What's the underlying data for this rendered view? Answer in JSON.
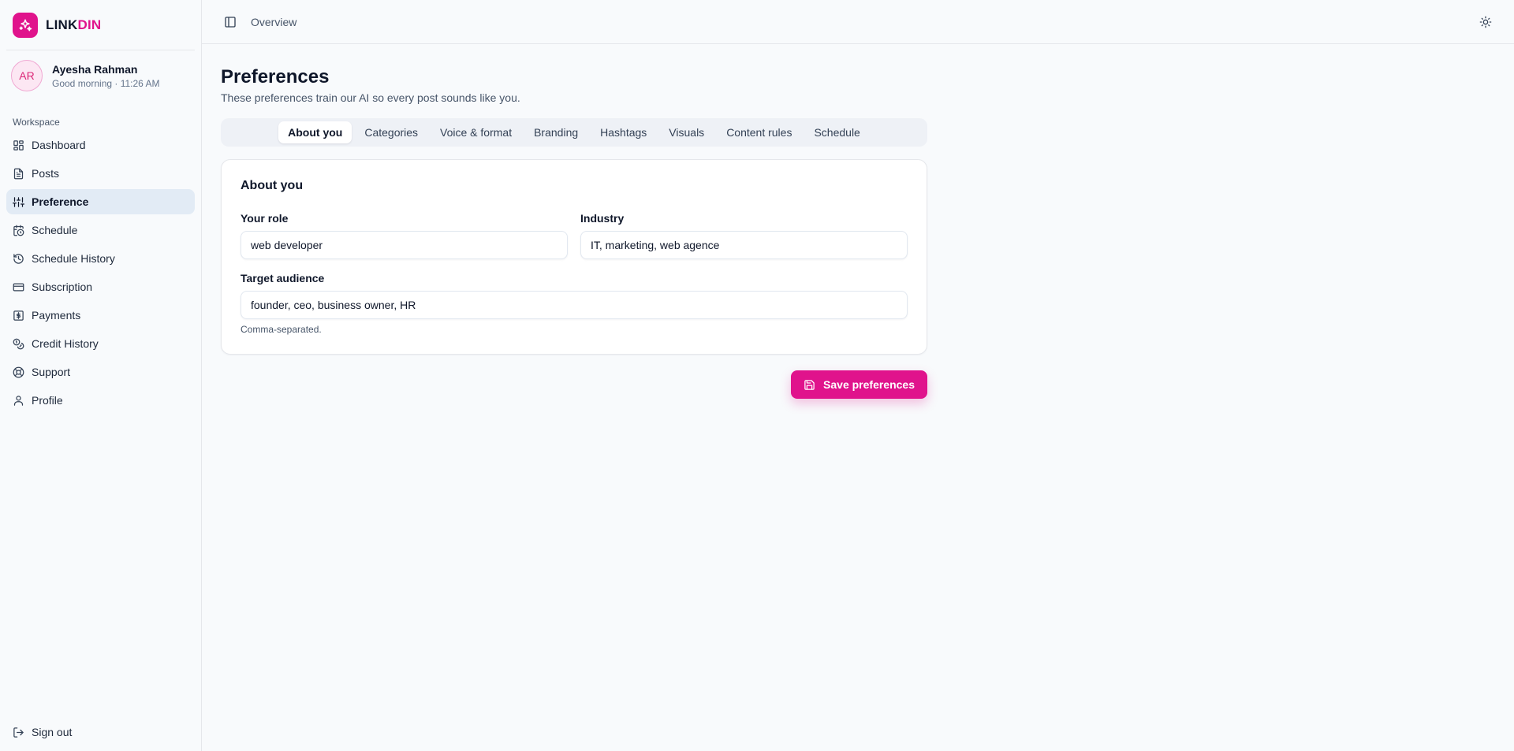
{
  "brand": {
    "name_part1": "LINK",
    "name_part2": "DIN",
    "accent": "#e0138c",
    "icon": "sparkles-icon"
  },
  "user": {
    "initials": "AR",
    "name": "Ayesha Rahman",
    "greeting": "Good morning · 11:26 AM"
  },
  "sidebar": {
    "section_label": "Workspace",
    "items": [
      {
        "label": "Dashboard",
        "icon": "dashboard-icon",
        "active": false
      },
      {
        "label": "Posts",
        "icon": "document-icon",
        "active": false
      },
      {
        "label": "Preference",
        "icon": "sliders-icon",
        "active": true
      },
      {
        "label": "Schedule",
        "icon": "calendar-clock-icon",
        "active": false
      },
      {
        "label": "Schedule History",
        "icon": "history-icon",
        "active": false
      },
      {
        "label": "Subscription",
        "icon": "credit-card-icon",
        "active": false
      },
      {
        "label": "Payments",
        "icon": "dollar-icon",
        "active": false
      },
      {
        "label": "Credit History",
        "icon": "coins-icon",
        "active": false
      },
      {
        "label": "Support",
        "icon": "lifebuoy-icon",
        "active": false
      },
      {
        "label": "Profile",
        "icon": "user-icon",
        "active": false
      }
    ],
    "signout_label": "Sign out"
  },
  "topbar": {
    "breadcrumb": "Overview"
  },
  "page": {
    "title": "Preferences",
    "subtitle": "These preferences train our AI so every post sounds like you."
  },
  "tabs": [
    {
      "label": "About you",
      "active": true
    },
    {
      "label": "Categories",
      "active": false
    },
    {
      "label": "Voice & format",
      "active": false
    },
    {
      "label": "Branding",
      "active": false
    },
    {
      "label": "Hashtags",
      "active": false
    },
    {
      "label": "Visuals",
      "active": false
    },
    {
      "label": "Content rules",
      "active": false
    },
    {
      "label": "Schedule",
      "active": false
    }
  ],
  "about": {
    "title": "About you",
    "role_label": "Your role",
    "role_value": "web developer",
    "industry_label": "Industry",
    "industry_value": "IT, marketing, web agence",
    "audience_label": "Target audience",
    "audience_value": "founder, ceo, business owner, HR",
    "audience_hint": "Comma-separated."
  },
  "actions": {
    "save_label": "Save preferences"
  }
}
